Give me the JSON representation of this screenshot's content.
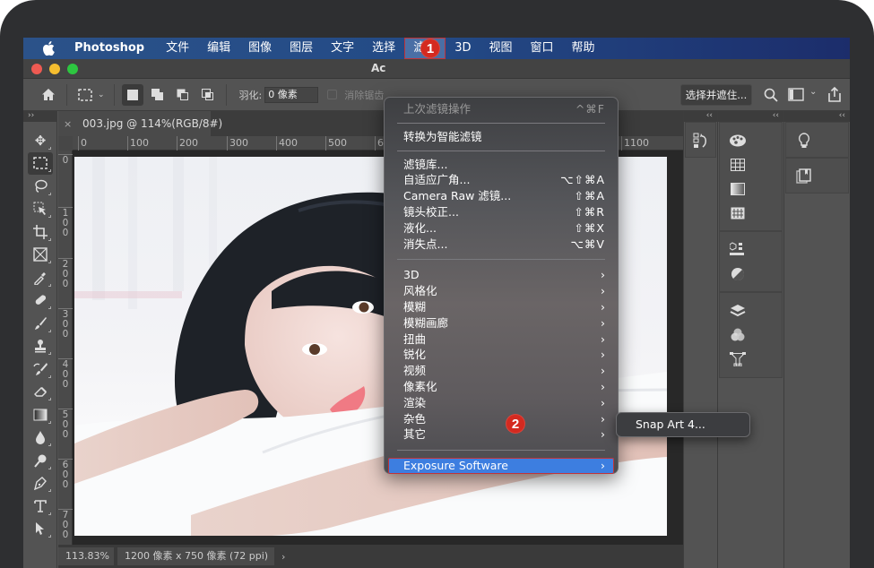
{
  "menubar": {
    "app_name": "Photoshop",
    "items": [
      "文件",
      "编辑",
      "图像",
      "图层",
      "文字",
      "选择",
      "滤镜",
      "3D",
      "视图",
      "窗口",
      "帮助"
    ],
    "active_item": "滤镜"
  },
  "window": {
    "title": "Ac"
  },
  "options_bar": {
    "feather_label": "羽化:",
    "feather_value": "0 像素",
    "antialias_label": "消除锯齿",
    "select_mask_label": "选择并遮住..."
  },
  "document": {
    "tab_label": "003.jpg @ 114%(RGB/8#)",
    "close_glyph": "×",
    "h_ruler_ticks": [
      "0",
      "100",
      "200",
      "300",
      "400",
      "500",
      "600",
      "1100"
    ],
    "v_ruler_ticks": [
      "0",
      "1\n0\n0",
      "2\n0\n0",
      "3\n0\n0",
      "4\n0\n0",
      "5\n0\n0",
      "6\n0\n0",
      "7\n0\n0"
    ],
    "status_zoom": "113.83%",
    "status_info": "1200 像素 x 750 像素 (72 ppi)",
    "status_arrow": "›"
  },
  "panels": {
    "collapse_glyph": "‹‹",
    "expand_glyph": "››"
  },
  "filter_menu": {
    "groups": [
      [
        {
          "label": "上次滤镜操作",
          "shortcut": "^⌘F",
          "disabled": true
        }
      ],
      [
        {
          "label": "转换为智能滤镜",
          "shortcut": ""
        }
      ],
      [
        {
          "label": "滤镜库...",
          "shortcut": ""
        },
        {
          "label": "自适应广角...",
          "shortcut": "⌥⇧⌘A"
        },
        {
          "label": "Camera Raw 滤镜...",
          "shortcut": "⇧⌘A"
        },
        {
          "label": "镜头校正...",
          "shortcut": "⇧⌘R"
        },
        {
          "label": "液化...",
          "shortcut": "⇧⌘X"
        },
        {
          "label": "消失点...",
          "shortcut": "⌥⌘V"
        }
      ],
      [
        {
          "label": "3D",
          "shortcut": "›"
        },
        {
          "label": "风格化",
          "shortcut": "›"
        },
        {
          "label": "模糊",
          "shortcut": "›"
        },
        {
          "label": "模糊画廊",
          "shortcut": "›"
        },
        {
          "label": "扭曲",
          "shortcut": "›"
        },
        {
          "label": "锐化",
          "shortcut": "›"
        },
        {
          "label": "视频",
          "shortcut": "›"
        },
        {
          "label": "像素化",
          "shortcut": "›"
        },
        {
          "label": "渲染",
          "shortcut": "›"
        },
        {
          "label": "杂色",
          "shortcut": "›"
        },
        {
          "label": "其它",
          "shortcut": "›"
        }
      ],
      [
        {
          "label": "Exposure Software",
          "shortcut": "›",
          "highlighted": true
        }
      ]
    ]
  },
  "submenu": {
    "items": [
      "Snap Art 4..."
    ]
  },
  "annotations": {
    "step1": "1",
    "step2": "2",
    "color": "#d42a20"
  },
  "colors": {
    "menubar_start": "#2b5289",
    "menubar_end": "#1c2d6b",
    "highlight": "#3d7ee0",
    "panel_bg": "#535353",
    "traffic_red": "#ee5a52",
    "traffic_yellow": "#f6be2f",
    "traffic_green": "#2dc640"
  }
}
